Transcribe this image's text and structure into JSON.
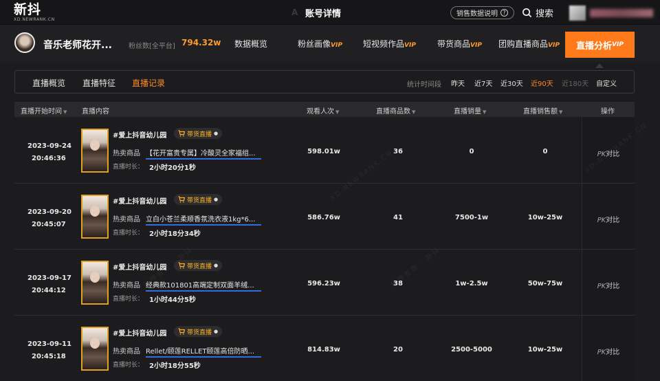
{
  "brand": {
    "name": "新抖",
    "sub": "XD.NEWRANK.CN"
  },
  "topbar": {
    "title": "账号详情",
    "title_ghost": "A      T",
    "sales_help": "销售数据说明",
    "search": "搜索"
  },
  "account": {
    "name": "音乐老师花开...",
    "fans_label": "粉丝数[全平台]",
    "fans_value": "794.32w"
  },
  "nav": {
    "overview": "数据概览",
    "fans_profile": "粉丝画像",
    "short_video": "短视频作品",
    "goods": "带货商品",
    "group_live_goods": "团购直播商品",
    "live_analysis": "直播分析",
    "vip": "VIP"
  },
  "subtabs": [
    "直播概览",
    "直播特征",
    "直播记录"
  ],
  "active_subtab": "直播记录",
  "time_range": {
    "label": "统计时间段",
    "options": [
      "昨天",
      "近7天",
      "近30天",
      "近90天",
      "近180天",
      "自定义"
    ],
    "active": "近90天"
  },
  "table": {
    "headers": {
      "start_time": "直播开始时间",
      "content": "直播内容",
      "viewers": "观看人次",
      "products": "直播商品数",
      "sales": "直播销量",
      "sales_amount": "直播销售额",
      "action": "操作"
    },
    "rows": [
      {
        "date": "2023-09-24",
        "time": "20:46:36",
        "title": "#爱上抖音幼儿园",
        "tag": "带货直播",
        "hot_label": "热卖商品",
        "hot_product": "【花开富贵专属】冷酸灵全家福组...",
        "duration_label": "直播时长：",
        "duration": "2小时20分1秒",
        "viewers": "598.01w",
        "products": "36",
        "sales": "0",
        "sales_amount": "0",
        "action": "对比",
        "action_pk": "PK"
      },
      {
        "date": "2023-09-20",
        "time": "20:45:07",
        "title": "#爱上抖音幼儿园",
        "tag": "带货直播",
        "hot_label": "热卖商品",
        "hot_product": "立白小苍兰柔顺香氛洗衣液1kg*6...",
        "duration_label": "直播时长：",
        "duration": "2小时18分34秒",
        "viewers": "586.76w",
        "products": "41",
        "sales": "7500-1w",
        "sales_amount": "10w-25w",
        "action": "对比",
        "action_pk": "PK"
      },
      {
        "date": "2023-09-17",
        "time": "20:44:12",
        "title": "#爱上抖音幼儿园",
        "tag": "带货直播",
        "hot_label": "热卖商品",
        "hot_product": "经典款101801高端定制双面羊绒...",
        "duration_label": "直播时长：",
        "duration": "1小时44分5秒",
        "viewers": "596.23w",
        "products": "38",
        "sales": "1w-2.5w",
        "sales_amount": "50w-75w",
        "action": "对比",
        "action_pk": "PK"
      },
      {
        "date": "2023-09-11",
        "time": "20:45:18",
        "title": "#爱上抖音幼儿园",
        "tag": "带货直播",
        "hot_label": "热卖商品",
        "hot_product": "Rellet/颐莲RELLET颐莲高倍防晒...",
        "duration_label": "直播时长：",
        "duration": "2小时18分55秒",
        "viewers": "814.83w",
        "products": "20",
        "sales": "2500-5000",
        "sales_amount": "10w-25w",
        "action": "对比",
        "action_pk": "PK"
      }
    ]
  },
  "colors": {
    "accent": "#ff7a1a",
    "link_underline": "#2f6fe0",
    "tag": "#ffb020"
  }
}
